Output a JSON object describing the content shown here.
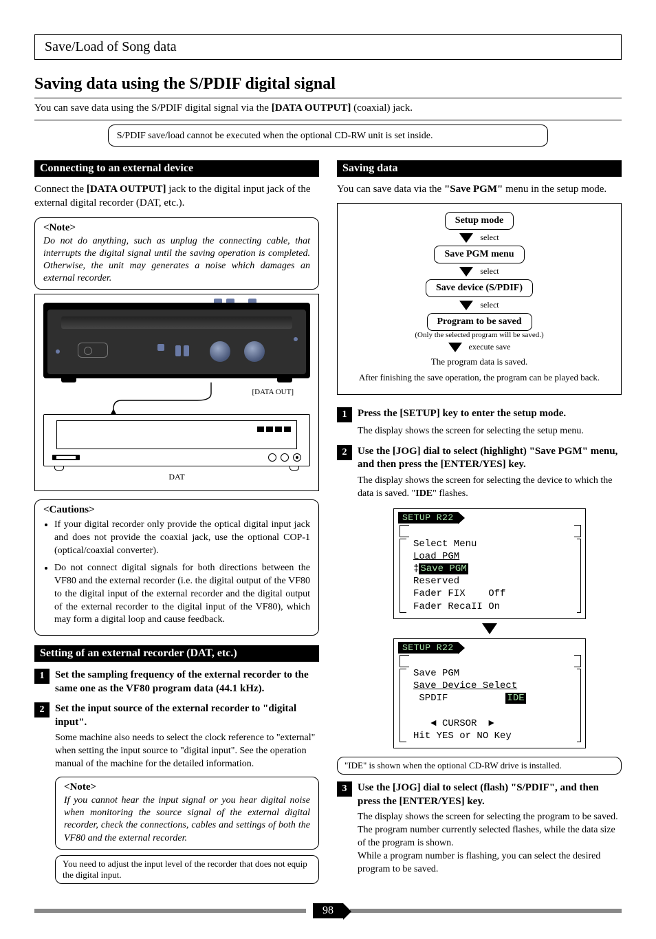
{
  "section_title": "Save/Load of Song data",
  "main_heading": "Saving data using the S/PDIF digital signal",
  "intro_left": "You can save data using the S/PDIF digital signal via the ",
  "intro_mid_bold": "[DATA OUTPUT]",
  "intro_right": " (coaxial) jack.",
  "intro_note": "S/PDIF save/load cannot be executed when the optional CD-RW unit is set inside.",
  "left": {
    "bar1": "Connecting to an external device",
    "p1a": "Connect the ",
    "p1b": "[DATA OUTPUT]",
    "p1c": " jack to the digital input jack of the external digital recorder (DAT, etc.).",
    "note_title": "<Note>",
    "note_body": "Do not do anything, such as unplug the connecting cable, that interrupts the digital signal until the saving operation is completed. Otherwise, the unit may generates a noise which damages an external recorder.",
    "cable_label": "[DATA OUT]",
    "dat_label": "DAT",
    "caution_title": "<Cautions>",
    "caution_b1": "If your digital recorder only provide the optical digital input jack and does not provide the coaxial jack, use the optional COP-1 (optical/coaxial converter).",
    "caution_b2": "Do not connect digital signals for both directions between the VF80 and the external recorder (i.e. the digital output of the VF80 to the digital input of the external recorder and the digital output of the external recorder to the digital input of the VF80), which may form a digital loop and cause feedback.",
    "bar2": "Setting of an external recorder (DAT, etc.)",
    "step1": "Set the sampling frequency of the external recorder to the same one as the VF80 program data (44.1 kHz).",
    "step2": "Set the input source of the external recorder to \"digital input\".",
    "step2_body": "Some machine also needs to select the clock reference to \"external\" when setting the input source to \"digital input\". See the operation manual of the machine for the detailed information.",
    "note2_title": "<Note>",
    "note2_body": "If you cannot hear the input signal or you hear digital noise when monitoring the source signal of the external digital recorder, check the connections, cables and settings of both the VF80 and the external recorder.",
    "tail_note": "You need to adjust the input level of the recorder that does not equip the digital input."
  },
  "right": {
    "bar1": "Saving data",
    "p1a": "You can save data via the ",
    "p1b": "\"Save PGM\"",
    "p1c": " menu in the setup mode.",
    "nav": {
      "n1": "Setup mode",
      "a1": "select",
      "n2": "Save PGM menu",
      "a2": "select",
      "n3": "Save device (S/PDIF)",
      "a3": "select",
      "n4": "Program to be saved",
      "n4_sub": "(Only the selected program will be saved.)",
      "a4": "execute save",
      "d1": "The program data is saved.",
      "d2": "After finishing the save operation, the program can be played back."
    },
    "step1": "Press the [SETUP] key to enter the setup mode.",
    "step1_body": "The display shows the screen for selecting the setup menu.",
    "step2a": "Use the [JOG] dial to select (highlight) ",
    "step2b": "\"Save PGM\"",
    "step2c": " menu, and then press the [ENTER/YES] key.",
    "step2_body_a": "The display shows the screen for selecting the device to which the data is saved. \"",
    "step2_body_b": "IDE",
    "step2_body_c": "\" flashes.",
    "lcd1": {
      "title": "SETUP R22",
      "header": "Select Menu",
      "l1": "Load PGM",
      "l2_inv": "Save PGM",
      "l3": "Reserved",
      "l4": "Fader FIX    Off",
      "l5": "Fader RecaII On"
    },
    "lcd2": {
      "title": "SETUP R22",
      "header": "Save PGM",
      "l1": "Save Device Select",
      "l2a": " SPDIF          ",
      "l2b_inv": "IDE",
      "l3": "   ◄ CURSOR  ►",
      "l4": "Hit YES or NO Key"
    },
    "mid_note": "\"IDE\" is shown when the optional CD-RW drive is installed.",
    "step3a": "Use the [JOG] dial to select (flash) \"",
    "step3b": "S/PDIF",
    "step3c": "\", and then press the [ENTER/YES] key.",
    "step3_body": "The display shows the screen for selecting the program to be saved.\nThe program number currently selected flashes, while the data size of the program is shown.\nWhile a program number is flashing, you can select the desired program to be saved."
  },
  "page_number": "98"
}
